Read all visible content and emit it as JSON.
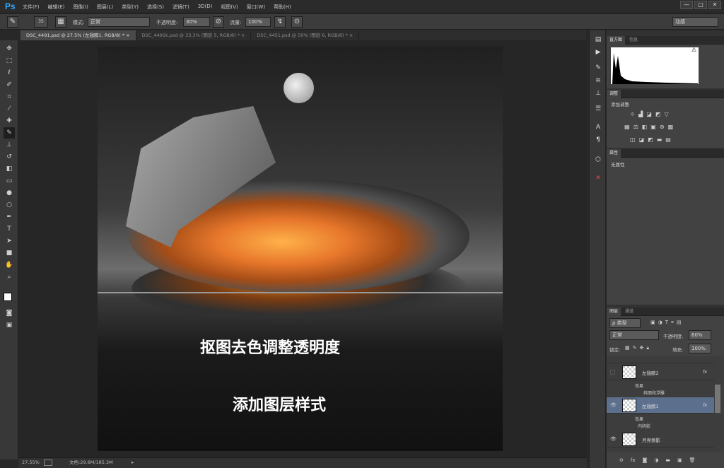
{
  "app": {
    "logo": "Ps"
  },
  "menu": [
    "文件(F)",
    "编辑(E)",
    "图像(I)",
    "图层(L)",
    "类型(Y)",
    "选择(S)",
    "滤镜(T)",
    "3D(D)",
    "视图(V)",
    "窗口(W)",
    "帮助(H)"
  ],
  "window_controls": {
    "minimize": "—",
    "restore": "□",
    "close": "✕"
  },
  "options": {
    "brush_size": "35",
    "mode_label": "模式:",
    "mode_value": "正常",
    "opacity_label": "不透明度:",
    "opacity_value": "30%",
    "flow_label": "流量:",
    "flow_value": "100%",
    "workspace": "动感"
  },
  "tabs": [
    "DSC_4491.psd @ 27.5% (左翅膀1, RGB/8) * ×",
    "DSC_4491k.psd @ 33.3% (图层 5, RGB/8) * ×",
    "DSC_4451.psd @ 50% (图层 6, RGB/8) * ×"
  ],
  "canvas": {
    "caption1": "抠图去色调整透明度",
    "caption2": "添加图层样式"
  },
  "status": {
    "zoom": "27.55%",
    "doc_info": "文档:29.6M/185.3M"
  },
  "panels": {
    "histogram_tabs": [
      "直方图",
      "信息"
    ],
    "adjust_tab": "调整",
    "adjust_title": "添加调整",
    "properties_tab": "属性",
    "properties_text": "无属性",
    "layers_tabs": [
      "图层",
      "通道"
    ],
    "filter_kind": "类型",
    "blend_mode": "正常",
    "opacity_label": "不透明度:",
    "opacity_value": "60%",
    "lock_label": "锁定:",
    "fill_label": "填充:",
    "fill_value": "100%",
    "layers": [
      {
        "name": "左翅膀2",
        "effects_label": "效果",
        "effect": "斜面和浮雕",
        "visible": false,
        "selected": false
      },
      {
        "name": "左翅膀1",
        "effects_label": "效果",
        "effect": "内阴影",
        "visible": true,
        "selected": true
      },
      {
        "name": "月亮倒影",
        "visible": true,
        "selected": false
      }
    ],
    "fx": "fx"
  },
  "colors": {
    "accent": "#31a8ff",
    "selected_layer": "#5c6f8c"
  }
}
